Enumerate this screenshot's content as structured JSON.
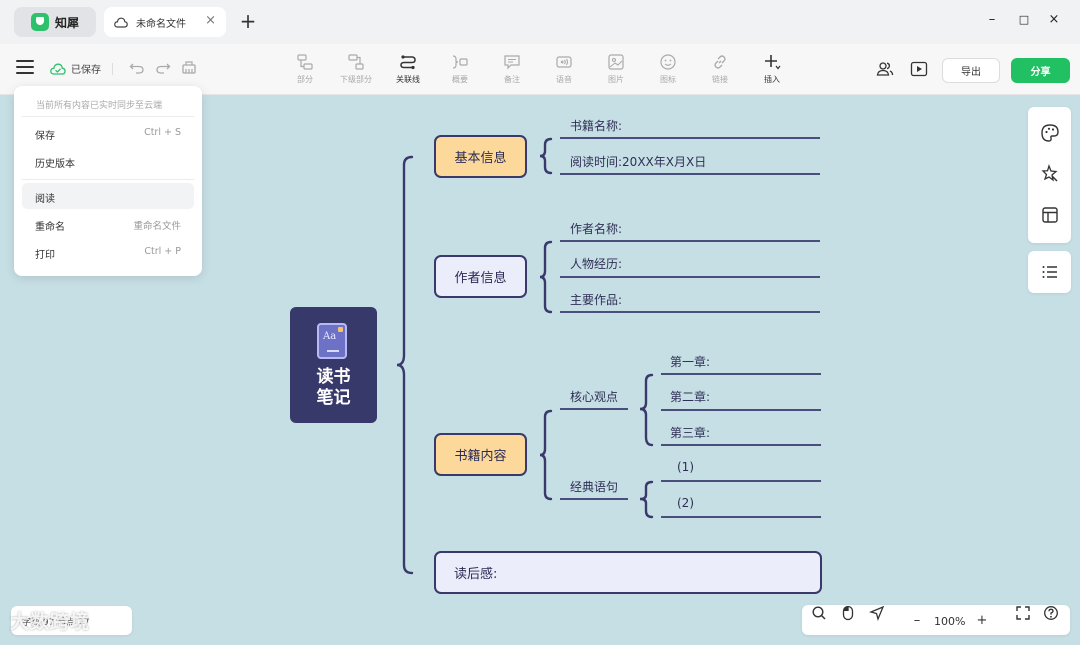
{
  "app": {
    "name": "知犀"
  },
  "tab": {
    "name": "未命名文件",
    "close": "×",
    "new_tab": "+"
  },
  "window": {
    "minimize": "–",
    "maximize": "□",
    "close": "×"
  },
  "toolbar": {
    "save_status": "已保存",
    "tools": [
      {
        "label": "部分",
        "icon": "branch-icon"
      },
      {
        "label": "下级部分",
        "icon": "sub-branch-icon"
      },
      {
        "label": "关联线",
        "icon": "relation-line-icon"
      },
      {
        "label": "概要",
        "icon": "summary-icon"
      },
      {
        "label": "备注",
        "icon": "note-icon"
      },
      {
        "label": "语音",
        "icon": "voice-icon"
      },
      {
        "label": "图片",
        "icon": "image-icon"
      },
      {
        "label": "图标",
        "icon": "emoji-icon"
      },
      {
        "label": "链接",
        "icon": "link-icon"
      },
      {
        "label": "插入",
        "icon": "insert-icon"
      }
    ],
    "export_label": "导出",
    "share_label": "分享"
  },
  "menu": {
    "sync_note": "当前所有内容已实时同步至云端",
    "items": [
      {
        "label": "保存",
        "shortcut": "Ctrl + S"
      },
      {
        "label": "历史版本",
        "shortcut": ""
      },
      {
        "label": "阅读",
        "shortcut": ""
      },
      {
        "label": "重命名",
        "shortcut": "重命名文件"
      },
      {
        "label": "打印",
        "shortcut": "Ctrl + P"
      }
    ]
  },
  "mindmap": {
    "root": {
      "line1": "读书",
      "line2": "笔记",
      "icon_text": "Aa"
    },
    "basic": {
      "label": "基本信息",
      "items": [
        "书籍名称:",
        "阅读时间:20XX年X月X日"
      ]
    },
    "author": {
      "label": "作者信息",
      "items": [
        "作者名称:",
        "人物经历:",
        "主要作品:"
      ]
    },
    "content": {
      "label": "书籍内容",
      "core": {
        "label": "核心观点",
        "items": [
          "第一章:",
          "第二章:",
          "第三章:"
        ]
      },
      "quotes": {
        "label": "经典语句",
        "items": [
          "(1)",
          "(2)"
        ]
      }
    },
    "after": {
      "label": "读后感:"
    }
  },
  "bottom": {
    "zoom": "100%",
    "zoom_out": "–",
    "zoom_in": "+",
    "stats": "字数 97  节点 27",
    "watermark": "大数跨境"
  },
  "colors": {
    "canvas": "#c6dfe5",
    "node_border": "#39396c",
    "accent_green": "#21c063",
    "yellow_node": "#fcd99a",
    "lilac_node": "#ecedfb"
  }
}
